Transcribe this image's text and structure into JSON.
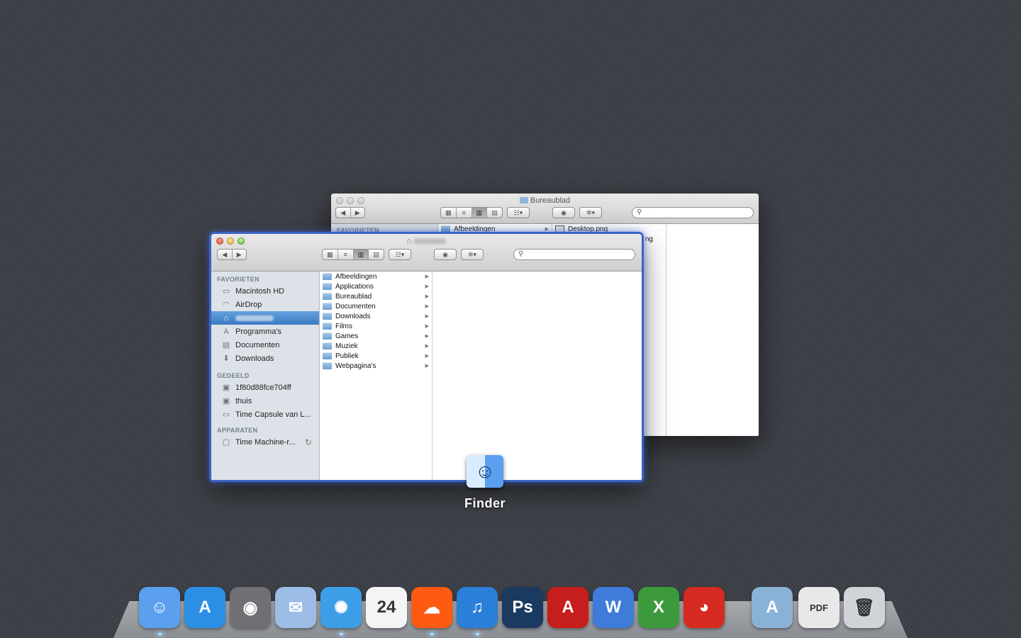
{
  "back_window": {
    "title": "Bureaublad",
    "sidebar_section": "FAVORIETEN",
    "col1_item": "Afbeeldingen",
    "col2_item": "Desktop.png",
    "col2_item2_fragment": "ng"
  },
  "front_window": {
    "title_redacted": true,
    "sidebar": {
      "favorites_title": "FAVORIETEN",
      "favorites": [
        {
          "label": "Macintosh HD",
          "icon": "hard-disk-icon"
        },
        {
          "label": "AirDrop",
          "icon": "airdrop-icon"
        },
        {
          "label": "",
          "icon": "home-icon",
          "selected": true
        },
        {
          "label": "Programma's",
          "icon": "applications-icon"
        },
        {
          "label": "Documenten",
          "icon": "documents-icon"
        },
        {
          "label": "Downloads",
          "icon": "downloads-icon"
        }
      ],
      "shared_title": "GEDEELD",
      "shared": [
        {
          "label": "1f80d88fce704ff",
          "icon": "computer-icon"
        },
        {
          "label": "thuis",
          "icon": "computer-icon"
        },
        {
          "label": "Time Capsule van L...",
          "icon": "time-capsule-icon"
        }
      ],
      "devices_title": "APPARATEN",
      "devices": [
        {
          "label": "Time Machine-r...",
          "icon": "disk-icon"
        }
      ]
    },
    "column1": [
      "Afbeeldingen",
      "Applications",
      "Bureaublad",
      "Documenten",
      "Downloads",
      "Films",
      "Games",
      "Muziek",
      "Publiek",
      "Webpagina's"
    ]
  },
  "switcher_label": "Finder",
  "dock": {
    "apps": [
      {
        "name": "finder-app-icon",
        "color": "#5aa0ef",
        "glyph": "☺",
        "running": true
      },
      {
        "name": "app-store-app-icon",
        "color": "#2c8fe6",
        "glyph": "A",
        "running": false
      },
      {
        "name": "facetime-app-icon",
        "color": "#6f6f74",
        "glyph": "◉",
        "running": false
      },
      {
        "name": "mail-app-icon",
        "color": "#9cbde6",
        "glyph": "✉",
        "running": false
      },
      {
        "name": "safari-app-icon",
        "color": "#3d9ee8",
        "glyph": "✺",
        "running": true
      },
      {
        "name": "calendar-app-icon",
        "color": "#f4f4f4",
        "glyph": "24",
        "running": false
      },
      {
        "name": "soundcloud-app-icon",
        "color": "#ff5a12",
        "glyph": "☁",
        "running": true
      },
      {
        "name": "itunes-app-icon",
        "color": "#2a7fd8",
        "glyph": "♫",
        "running": true
      },
      {
        "name": "photoshop-app-icon",
        "color": "#1a3a5f",
        "glyph": "Ps",
        "running": false
      },
      {
        "name": "autocad-app-icon",
        "color": "#c61d1d",
        "glyph": "A",
        "running": false
      },
      {
        "name": "word-app-icon",
        "color": "#3f7bd8",
        "glyph": "W",
        "running": false
      },
      {
        "name": "excel-app-icon",
        "color": "#3c9a3c",
        "glyph": "X",
        "running": false
      },
      {
        "name": "angry-birds-app-icon",
        "color": "#d62b20",
        "glyph": "◕",
        "running": false
      },
      {
        "name": "applications-folder-icon",
        "color": "#89b2d6",
        "glyph": "A",
        "running": false
      },
      {
        "name": "pdf-document-icon",
        "color": "#e8e8e8",
        "glyph": "PDF",
        "running": false
      },
      {
        "name": "trash-icon",
        "color": "#cfd4d8",
        "glyph": "🗑",
        "running": false
      }
    ]
  }
}
